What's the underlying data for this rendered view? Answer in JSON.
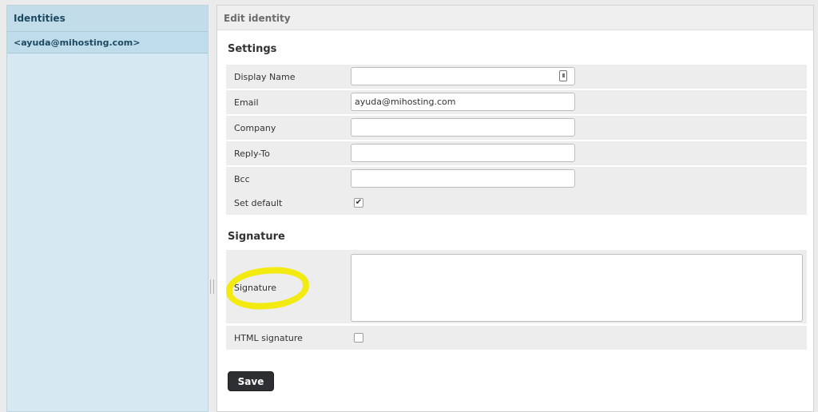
{
  "sidebar": {
    "title": "Identities",
    "identities": [
      "<ayuda@mihosting.com>"
    ]
  },
  "main": {
    "title": "Edit identity",
    "settings_title": "Settings",
    "fields": {
      "display_name": {
        "label": "Display Name",
        "value": ""
      },
      "email": {
        "label": "Email",
        "value": "ayuda@mihosting.com"
      },
      "company": {
        "label": "Company",
        "value": ""
      },
      "reply_to": {
        "label": "Reply-To",
        "value": ""
      },
      "bcc": {
        "label": "Bcc",
        "value": ""
      }
    },
    "set_default": {
      "label": "Set default",
      "checked": true,
      "mark": "✔"
    },
    "signature_title": "Signature",
    "signature": {
      "label": "Signature",
      "value": ""
    },
    "html_signature": {
      "label": "HTML signature",
      "checked": false
    },
    "save_label": "Save"
  },
  "icons": {
    "contact": "contact-card-icon",
    "resize": "resize-grip-icon"
  },
  "colors": {
    "sidebar_bg": "#d6e9f2",
    "highlight": "#f3ea11",
    "save_button": "#2d2f33"
  }
}
